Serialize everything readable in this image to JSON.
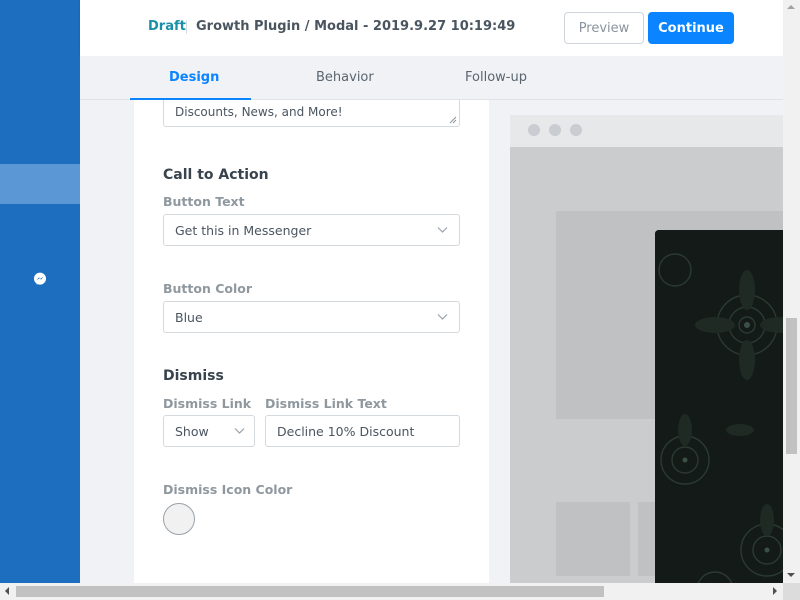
{
  "header": {
    "status": "Draft",
    "title": "Growth Plugin / Modal - 2019.9.27 10:19:49",
    "preview_label": "Preview",
    "continue_label": "Continue"
  },
  "tabs": [
    {
      "label": "Design",
      "active": true
    },
    {
      "label": "Behavior",
      "active": false
    },
    {
      "label": "Follow-up",
      "active": false
    }
  ],
  "form": {
    "textarea_value": "Discounts, News, and More!",
    "cta": {
      "title": "Call to Action",
      "button_text_label": "Button Text",
      "button_text_value": "Get this in Messenger",
      "button_color_label": "Button Color",
      "button_color_value": "Blue"
    },
    "dismiss": {
      "title": "Dismiss",
      "link_label": "Dismiss Link",
      "link_value": "Show",
      "link_text_label": "Dismiss Link Text",
      "link_text_value": "Decline 10% Discount",
      "icon_color_label": "Dismiss Icon Color"
    }
  },
  "colors": {
    "accent": "#0a84ff",
    "sidebar": "#1d6ebe",
    "status": "#1a8fa8"
  },
  "icons": {
    "sidebar": "messenger-icon",
    "select": "chevron-down-icon"
  }
}
